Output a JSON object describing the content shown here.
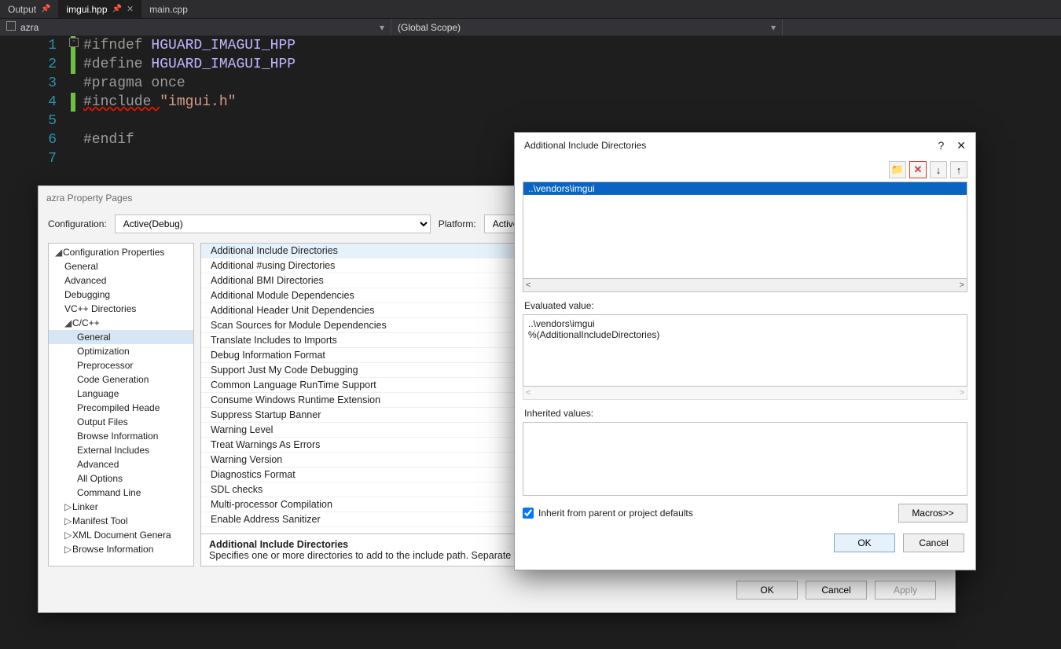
{
  "tabs": {
    "output": {
      "label": "Output",
      "pin": "📌"
    },
    "active": {
      "label": "imgui.hpp",
      "pin": "📌",
      "close": "✕"
    },
    "other": {
      "label": "main.cpp"
    }
  },
  "scopebar": {
    "project": "azra",
    "scope": "(Global Scope)",
    "caret": "▾"
  },
  "code": {
    "lines": [
      "1",
      "2",
      "3",
      "4",
      "5",
      "6",
      "7"
    ],
    "l1": {
      "a": "#ifndef ",
      "b": "HGUARD_IMAGUI_HPP"
    },
    "l2": {
      "a": "#define ",
      "b": "HGUARD_IMAGUI_HPP"
    },
    "l3": {
      "a": "#pragma ",
      "b": "once"
    },
    "l4": {
      "a": "#include ",
      "b": "\"imgui.h\""
    },
    "l6": {
      "a": "#endif"
    }
  },
  "prop": {
    "title": "azra Property Pages",
    "config_label": "Configuration:",
    "config_value": "Active(Debug)",
    "platform_label": "Platform:",
    "platform_value": "Active",
    "tree": {
      "root": "Configuration Properties",
      "items": [
        "General",
        "Advanced",
        "Debugging",
        "VC++ Directories"
      ],
      "cpp": "C/C++",
      "cpp_items": [
        "General",
        "Optimization",
        "Preprocessor",
        "Code Generation",
        "Language",
        "Precompiled Heade",
        "Output Files",
        "Browse Information",
        "External Includes",
        "Advanced",
        "All Options",
        "Command Line"
      ],
      "after": [
        "Linker",
        "Manifest Tool",
        "XML Document Genera",
        "Browse Information"
      ],
      "exp_open": "◢",
      "exp_closed": "▷"
    },
    "rows": [
      "Additional Include Directories",
      "Additional #using Directories",
      "Additional BMI Directories",
      "Additional Module Dependencies",
      "Additional Header Unit Dependencies",
      "Scan Sources for Module Dependencies",
      "Translate Includes to Imports",
      "Debug Information Format",
      "Support Just My Code Debugging",
      "Common Language RunTime Support",
      "Consume Windows Runtime Extension",
      "Suppress Startup Banner",
      "Warning Level",
      "Treat Warnings As Errors",
      "Warning Version",
      "Diagnostics Format",
      "SDL checks",
      "Multi-processor Compilation",
      "Enable Address Sanitizer"
    ],
    "desc_title": "Additional Include Directories",
    "desc_body": "Specifies one or more directories to add to the include path. Separate with ';",
    "ok": "OK",
    "cancel": "Cancel",
    "apply": "Apply"
  },
  "inc": {
    "title": "Additional Include Directories",
    "help": "?",
    "close": "✕",
    "tool_new": "📁",
    "tool_del": "✕",
    "tool_down": "↓",
    "tool_up": "↑",
    "entry": "..\\vendors\\imgui",
    "scroll_left": "<",
    "scroll_right": ">",
    "eval_label": "Evaluated value:",
    "eval_lines": [
      "..\\vendors\\imgui",
      "%(AdditionalIncludeDirectories)"
    ],
    "inh_label": "Inherited values:",
    "inherit_check": "Inherit from parent or project defaults",
    "macros": "Macros>>",
    "ok": "OK",
    "cancel": "Cancel"
  }
}
